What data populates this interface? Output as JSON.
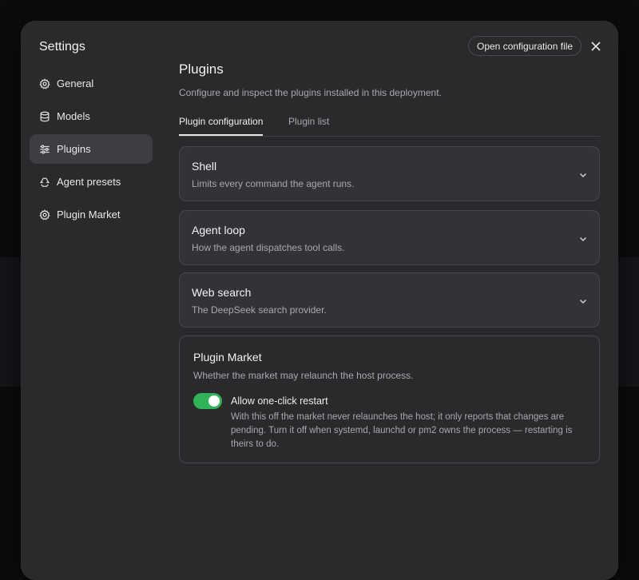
{
  "modal": {
    "title": "Settings",
    "open_config_label": "Open configuration file"
  },
  "sidebar": {
    "items": [
      {
        "label": "General",
        "icon": "gear-icon",
        "active": false
      },
      {
        "label": "Models",
        "icon": "database-icon",
        "active": false
      },
      {
        "label": "Plugins",
        "icon": "sliders-icon",
        "active": true
      },
      {
        "label": "Agent presets",
        "icon": "recycle-icon",
        "active": false
      },
      {
        "label": "Plugin Market",
        "icon": "gear-icon",
        "active": false
      }
    ]
  },
  "main": {
    "title": "Plugins",
    "subtitle": "Configure and inspect the plugins installed in this deployment.",
    "tabs": [
      {
        "label": "Plugin configuration",
        "active": true
      },
      {
        "label": "Plugin list",
        "active": false
      }
    ],
    "sections": [
      {
        "title": "Shell",
        "description": "Limits every command the agent runs."
      },
      {
        "title": "Agent loop",
        "description": "How the agent dispatches tool calls."
      },
      {
        "title": "Web search",
        "description": "The DeepSeek search provider."
      }
    ],
    "market": {
      "title": "Plugin Market",
      "description": "Whether the market may relaunch the host process.",
      "toggle_label": "Allow one-click restart",
      "toggle_on": true,
      "toggle_help": "With this off the market never relaunches the host; it only reports that changes are pending. Turn it off when systemd, launchd or pm2 owns the process — restarting is theirs to do."
    }
  },
  "colors": {
    "accent_toggle": "#2fb356",
    "modal_bg": "#2a2a2c",
    "active_nav_bg": "#3d3e42"
  }
}
